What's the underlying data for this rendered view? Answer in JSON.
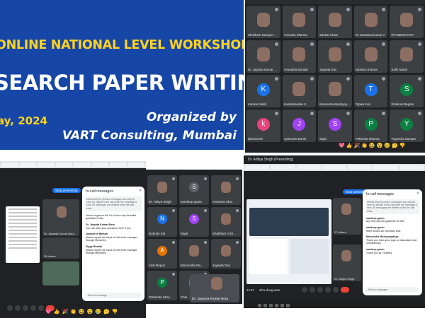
{
  "banner": {
    "line1": "ONLINE NATIONAL LEVEL WORKSHOP ON",
    "line2": "SEARCH PAPER WRITING",
    "date": "ay, 2024",
    "organized_by": "Organized by",
    "organizer": "VART Consulting, Mumbai"
  },
  "top_right_grid": {
    "participants": [
      {
        "name": "Shubham Narayan Shelt",
        "avatar": "",
        "color": ""
      },
      {
        "name": "Aneesha Sharma",
        "avatar": "",
        "color": ""
      },
      {
        "name": "Sankar Chaw",
        "avatar": "",
        "color": ""
      },
      {
        "name": "Dr Saranana kumar V",
        "avatar": "",
        "color": ""
      },
      {
        "name": "PITAMBAR ROY",
        "avatar": "",
        "color": ""
      },
      {
        "name": "Dr. Jayanta Kumar Bora",
        "avatar": "",
        "color": ""
      },
      {
        "name": "Anuradha Mondal",
        "avatar": "",
        "color": ""
      },
      {
        "name": "Jayanta Das",
        "avatar": "",
        "color": ""
      },
      {
        "name": "subham sharma",
        "avatar": "",
        "color": ""
      },
      {
        "name": "Sathi Nandi",
        "avatar": "",
        "color": ""
      },
      {
        "name": "Kamran Siddi",
        "avatar": "K",
        "color": "#1a73e8"
      },
      {
        "name": "Kushalnandan S",
        "avatar": "",
        "color": ""
      },
      {
        "name": "Monorisha Mushyopadhya...",
        "avatar": "",
        "color": ""
      },
      {
        "name": "Tapasi Kari",
        "avatar": "T",
        "color": "#1a73e8"
      },
      {
        "name": "Shahnaz Begam",
        "avatar": "S",
        "color": "#0b8043"
      },
      {
        "name": "kala kat Kh",
        "avatar": "k",
        "color": "#e8437a"
      },
      {
        "name": "Jyotismita Borah",
        "avatar": "J",
        "color": "#a142f4"
      },
      {
        "name": "Sajal",
        "avatar": "S",
        "color": "#a142f4"
      },
      {
        "name": "Pritismita Sharma",
        "avatar": "P",
        "color": "#0b8043"
      },
      {
        "name": "Yogendra Sampat",
        "avatar": "Y",
        "color": "#0b8043"
      }
    ],
    "reactions": [
      "💖",
      "👍",
      "🎉",
      "👏",
      "😂",
      "😮",
      "😢",
      "🤔",
      "👎"
    ]
  },
  "bottom_left": {
    "stop_presenting": "Stop presenting",
    "chat_title": "In-call messages",
    "chat_info": "Unless they're pinned, messages can only be seen by people in the call when the message is sent. All messages are deleted when the call ends.",
    "messages": [
      {
        "sender": "",
        "text": "How to organize the Lit in there any formalist guideline to this"
      },
      {
        "sender": "Dr. Jayanta Kumar Bora",
        "text": "You can write your questions here if you"
      },
      {
        "sender": "Jayashree Barkati",
        "text": "please repeat the steps of reference manager through Mendeley"
      },
      {
        "sender": "Sippy Bhadra",
        "text": "please repeat the steps of reference manager through Mendeley"
      }
    ],
    "send_placeholder": "Send a message",
    "side_tiles": [
      {
        "name": "Dr. Jayanta Kumar Bora"
      },
      {
        "name": "29 others"
      }
    ]
  },
  "middle_grid": {
    "tiles": [
      {
        "name": "Dr. Aditya Singh",
        "avatar": "",
        "color": ""
      },
      {
        "name": "sandeep guran",
        "avatar": "S",
        "color": "#5f6368"
      },
      {
        "name": "Aneesha Sha...",
        "avatar": "",
        "color": ""
      },
      {
        "name": "Nobody Kid",
        "avatar": "N",
        "color": "#1a73e8"
      },
      {
        "name": "Sajal",
        "avatar": "S",
        "color": "#a142f4"
      },
      {
        "name": "Shubham N Di...",
        "avatar": "",
        "color": ""
      },
      {
        "name": "Alok Regon",
        "avatar": "A",
        "color": "#e37400"
      },
      {
        "name": "Monorisha Mu...",
        "avatar": "",
        "color": ""
      },
      {
        "name": "Jayanta Das",
        "avatar": "",
        "color": ""
      },
      {
        "name": "Pritismita Shar...",
        "avatar": "P",
        "color": "#0b8043"
      },
      {
        "name": "Chel",
        "avatar": "",
        "color": ""
      }
    ],
    "floating_tile": "Dr. Jayanta Kumar Bora",
    "reactions": [
      "💖",
      "👍",
      "🎉",
      "👏",
      "😂",
      "😮",
      "😢",
      "🤔",
      "👎"
    ]
  },
  "bottom_right": {
    "presenting_label": "Dr. Aditya Singh (Presenting)",
    "stop_presenting": "Stop presenting",
    "chat_title": "In-call messages",
    "chat_info": "Unless they're pinned, messages can only be seen by people in the call when the message is sent. All messages are deleted when the call ends.",
    "messages": [
      {
        "sender": "sandeep guran",
        "text": "any new specific guideline for this"
      },
      {
        "sender": "sandeep guran",
        "text": "Write should an important look"
      },
      {
        "sender": "Monorisha Mushyopadhya...",
        "text": "Thank you mam your topic or discussion and conclusion(L)"
      },
      {
        "sender": "sandeep guran",
        "text": "Thank you sir. Grateful"
      }
    ],
    "send_placeholder": "Send a message",
    "side_tiles": [
      {
        "name": "27 others"
      },
      {
        "name": "Dr. Aditya Singh"
      }
    ],
    "meeting_code": "who-duvg-wan",
    "time": "11:07"
  }
}
